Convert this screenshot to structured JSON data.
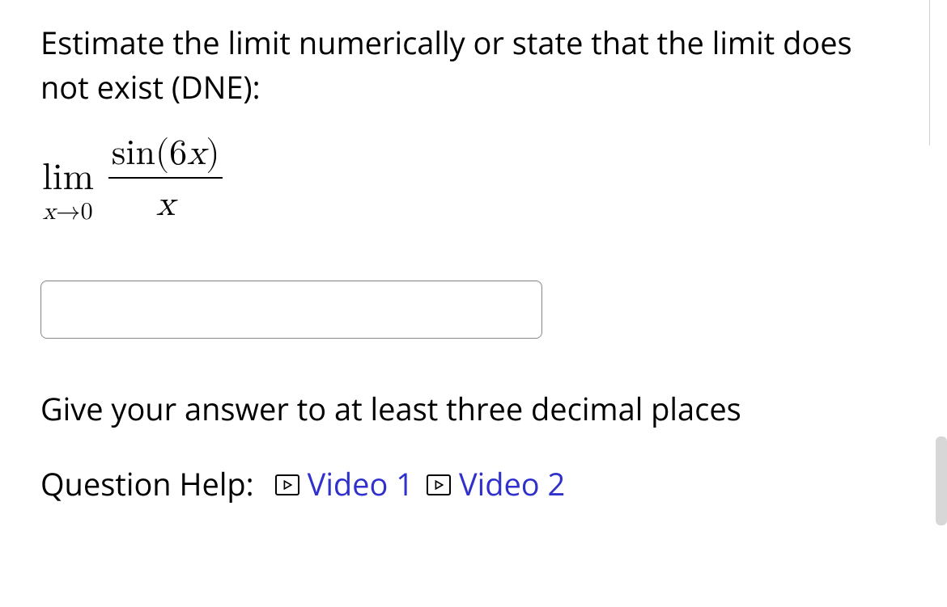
{
  "prompt": "Estimate the limit numerically or state that the limit does not exist (DNE):",
  "math": {
    "lim": "lim",
    "approach_var": "x",
    "approach_arrow": "→",
    "approach_val": "0",
    "numerator_func": "sin",
    "numerator_open": "(",
    "numerator_coef": "6",
    "numerator_var": "x",
    "numerator_close": ")",
    "denominator": "x"
  },
  "answer_value": "",
  "instruction": "Give your answer to at least three decimal places",
  "help": {
    "label": "Question Help:",
    "video1": "Video 1",
    "video2": "Video 2"
  }
}
